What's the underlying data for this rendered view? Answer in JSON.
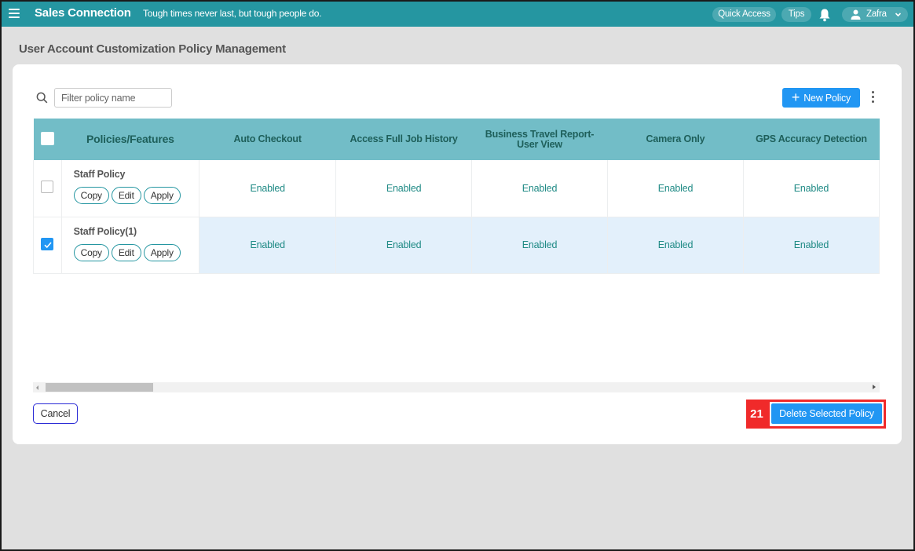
{
  "app": {
    "brand": "Sales Connection",
    "tagline": "Tough times never last, but tough people do.",
    "quick_access_label": "Quick Access",
    "tips_label": "Tips",
    "user_name": "Zafra",
    "accent_color": "#2596a1"
  },
  "page": {
    "title": "User Account Customization Policy Management"
  },
  "toolbar": {
    "filter_placeholder": "Filter policy name",
    "filter_value": "",
    "new_policy_label": "New Policy"
  },
  "table": {
    "features_header": "Policies/Features",
    "columns": [
      "Auto Checkout",
      "Access Full Job History",
      "Business Travel Report-User View",
      "Camera Only",
      "GPS Accuracy Detection"
    ],
    "row_actions": {
      "copy": "Copy",
      "edit": "Edit",
      "apply": "Apply"
    },
    "rows": [
      {
        "name": "Staff Policy",
        "checked": false,
        "values": [
          "Enabled",
          "Enabled",
          "Enabled",
          "Enabled",
          "Enabled"
        ]
      },
      {
        "name": "Staff Policy(1)",
        "checked": true,
        "values": [
          "Enabled",
          "Enabled",
          "Enabled",
          "Enabled",
          "Enabled"
        ]
      }
    ]
  },
  "footer": {
    "cancel_label": "Cancel",
    "delete_label": "Delete Selected Policy"
  },
  "annotation": {
    "label": "21",
    "color": "#f02a2a"
  }
}
